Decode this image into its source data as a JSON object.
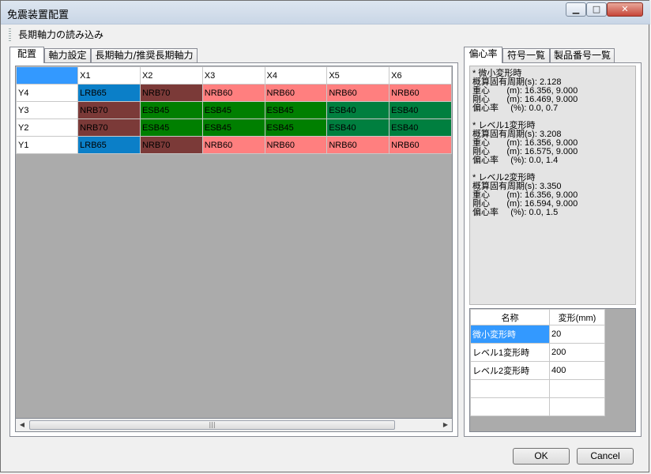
{
  "window": {
    "title": "免震装置配置"
  },
  "toolbar": {
    "load_button": "長期軸力の読み込み"
  },
  "left_tabs": [
    "配置",
    "軸力設定",
    "長期軸力/推奨長期軸力"
  ],
  "grid": {
    "columns": [
      "X1",
      "X2",
      "X3",
      "X4",
      "X5",
      "X6"
    ],
    "rows": [
      {
        "label": "Y4",
        "cells": [
          "LRB65",
          "NRB70",
          "NRB60",
          "NRB60",
          "NRB60",
          "NRB60"
        ]
      },
      {
        "label": "Y3",
        "cells": [
          "NRB70",
          "ESB45",
          "ESB45",
          "ESB45",
          "ESB40",
          "ESB40"
        ]
      },
      {
        "label": "Y2",
        "cells": [
          "NRB70",
          "ESB45",
          "ESB45",
          "ESB45",
          "ESB40",
          "ESB40"
        ]
      },
      {
        "label": "Y1",
        "cells": [
          "LRB65",
          "NRB70",
          "NRB60",
          "NRB60",
          "NRB60",
          "NRB60"
        ]
      }
    ],
    "type_colors": {
      "LRB65": "#0b7fc8",
      "NRB70": "#7b3a38",
      "NRB60": "#ff7f7f",
      "ESB45": "#007f00",
      "ESB40": "#007f3f"
    },
    "corner_color": "#3399ff"
  },
  "right_tabs": [
    "偏心率",
    "符号一覧",
    "製品番号一覧"
  ],
  "eccentricity_lines": [
    "* 微小変形時",
    "概算固有周期(s): 2.128",
    "重心       (m): 16.356, 9.000",
    "剛心       (m): 16.469, 9.000",
    "偏心率     (%): 0.0, 0.7",
    "",
    "* レベル1変形時",
    "概算固有周期(s): 3.208",
    "重心       (m): 16.356, 9.000",
    "剛心       (m): 16.575, 9.000",
    "偏心率     (%): 0.0, 1.4",
    "",
    "* レベル2変形時",
    "概算固有周期(s): 3.350",
    "重心       (m): 16.356, 9.000",
    "剛心       (m): 16.594, 9.000",
    "偏心率     (%): 0.0, 1.5"
  ],
  "deformation_table": {
    "headers": [
      "名称",
      "変形(mm)"
    ],
    "rows": [
      {
        "name": "微小変形時",
        "value": "20"
      },
      {
        "name": "レベル1変形時",
        "value": "200"
      },
      {
        "name": "レベル2変形時",
        "value": "400"
      },
      {
        "name": "",
        "value": ""
      },
      {
        "name": "",
        "value": ""
      }
    ],
    "selected_color": "#3399ff"
  },
  "buttons": {
    "ok": "OK",
    "cancel": "Cancel"
  }
}
